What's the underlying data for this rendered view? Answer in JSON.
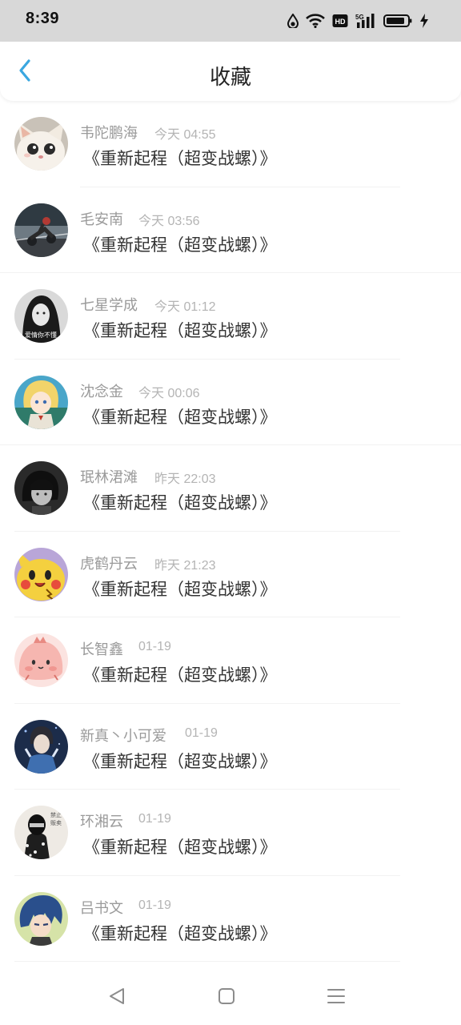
{
  "status_bar": {
    "time": "8:39",
    "icons": [
      "water-drop-icon",
      "wifi-icon",
      "hd-icon",
      "5g-signal-icon",
      "battery-icon",
      "charging-icon"
    ]
  },
  "header": {
    "title": "收藏",
    "back_icon": "chevron-left-icon",
    "accent_color": "#3aa7e0"
  },
  "favorites": [
    {
      "name": "韦陀鹏海",
      "time": "今天 04:55",
      "title": "《重新起程（超变战螺）》",
      "avatar": "white-cat-avatar"
    },
    {
      "name": "毛安南",
      "time": "今天 03:56",
      "title": "《重新起程（超变战螺）》",
      "avatar": "motorbike-avatar"
    },
    {
      "name": "七星学成",
      "time": "今天 01:12",
      "title": "《重新起程（超变战螺）》",
      "avatar": "girl-bw-avatar"
    },
    {
      "name": "沈念金",
      "time": "今天 00:06",
      "title": "《重新起程（超变战螺）》",
      "avatar": "anime-blonde-avatar"
    },
    {
      "name": "珉林涒滩",
      "time": "昨天 22:03",
      "title": "《重新起程（超变战螺）》",
      "avatar": "child-bw-avatar"
    },
    {
      "name": "虎鹤丹云",
      "time": "昨天 21:23",
      "title": "《重新起程（超变战螺）》",
      "avatar": "pikachu-avatar"
    },
    {
      "name": "长智鑫",
      "time": "01-19",
      "title": "《重新起程（超变战螺）》",
      "avatar": "pink-blob-avatar"
    },
    {
      "name": "新真丶小可爱",
      "time": "01-19",
      "title": "《重新起程（超变战螺）》",
      "avatar": "boy-blue-avatar"
    },
    {
      "name": "环湘云",
      "time": "01-19",
      "title": "《重新起程（超变战螺）》",
      "avatar": "masked-person-avatar"
    },
    {
      "name": "吕书文",
      "time": "01-19",
      "title": "《重新起程（超变战螺）》",
      "avatar": "anime-blue-hair-avatar"
    }
  ],
  "nav_bar": {
    "buttons": [
      "back-triangle-icon",
      "home-square-icon",
      "menu-lines-icon"
    ]
  }
}
